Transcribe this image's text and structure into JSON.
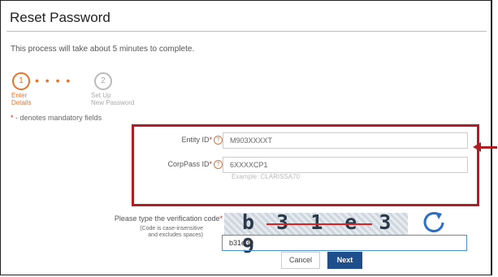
{
  "page": {
    "title": "Reset Password",
    "info": "This process will take about 5 minutes to complete."
  },
  "steps": [
    {
      "number": "1",
      "label_line1": "Enter",
      "label_line2": "Details",
      "status": "active"
    },
    {
      "number": "2",
      "label_line1": "Set Up",
      "label_line2": "New Password",
      "status": "pending"
    }
  ],
  "mandatory_note": {
    "star": "*",
    "text": " - denotes mandatory fields"
  },
  "form": {
    "entity_id": {
      "label": "Entity ID",
      "star": "*",
      "help": "?",
      "value": "M903XXXXT"
    },
    "corppass_id": {
      "label": "CorpPass ID",
      "star": "*",
      "help": "?",
      "value": "6XXXXCP1",
      "hint": "Example: CLARISSA70"
    },
    "verification": {
      "label": "Please type the verification code",
      "star": "*",
      "caption_line1": "(Code is case-insensitive",
      "caption_line2": "and excludes spaces)",
      "captcha_text": "b31e39",
      "value": "b31e39"
    }
  },
  "buttons": {
    "cancel": "Cancel",
    "next": "Next"
  },
  "colors": {
    "accent": "#e8732a",
    "highlight": "#b01e24",
    "primary": "#1f4e8c",
    "required": "#e02020"
  },
  "icons": {
    "refresh": "refresh-icon",
    "help": "help-icon",
    "arrow": "arrow-left-icon"
  }
}
